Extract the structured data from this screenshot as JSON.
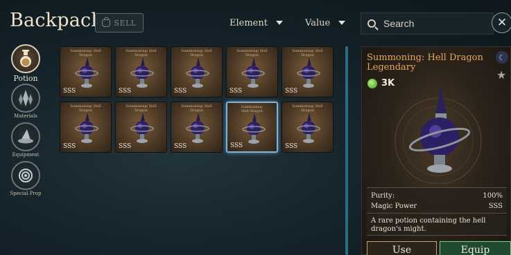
{
  "header": {
    "title": "Backpack",
    "sell_label": "SELL",
    "element_filter": "Element",
    "value_filter": "Value",
    "search_placeholder": "Search"
  },
  "categories": [
    {
      "label": "Potion",
      "icon": "potion-flask-icon",
      "active": true
    },
    {
      "label": "Materials",
      "icon": "crystal-icon",
      "active": false
    },
    {
      "label": "Equipment",
      "icon": "wizard-hat-icon",
      "active": false
    },
    {
      "label": "Special Prop",
      "icon": "spiral-orb-icon",
      "active": false
    }
  ],
  "items": [
    {
      "name": "Summoning: Hell Dragon",
      "rank": "SSS",
      "selected": false
    },
    {
      "name": "Summoning: Hell Dragon",
      "rank": "SSS",
      "selected": false
    },
    {
      "name": "Summoning: Hell Dragon",
      "rank": "SSS",
      "selected": false
    },
    {
      "name": "Summoning: Hell Dragon",
      "rank": "SSS",
      "selected": false
    },
    {
      "name": "Summoning: Hell Dragon",
      "rank": "SSS",
      "selected": false
    },
    {
      "name": "Summoning: Hell Dragon",
      "rank": "SSS",
      "selected": false
    },
    {
      "name": "Summoning: Hell Dragon",
      "rank": "SSS",
      "selected": false
    },
    {
      "name": "Summoning: Hell Dragon",
      "rank": "SSS",
      "selected": false
    },
    {
      "name": "Summoning: Hell Dragon",
      "rank": "SSS",
      "selected": true
    },
    {
      "name": "Summoning: Hell Dragon",
      "rank": "SSS",
      "selected": false
    }
  ],
  "detail": {
    "name": "Summoning: Hell Dragon Legendary",
    "price": "3K",
    "purity_label": "Purity:",
    "purity_value": "100%",
    "magic_power_label": "Magic Power",
    "magic_power_value": "SSS",
    "description": "A rare potion containing the hell dragon's might.",
    "use_label": "Use",
    "equip_label": "Equip"
  },
  "colors": {
    "name_orange": "#e6a75a",
    "selection_blue": "#7fb4d8",
    "equip_green": "#1e4a30",
    "scrollbar_teal": "#2b6d80"
  }
}
